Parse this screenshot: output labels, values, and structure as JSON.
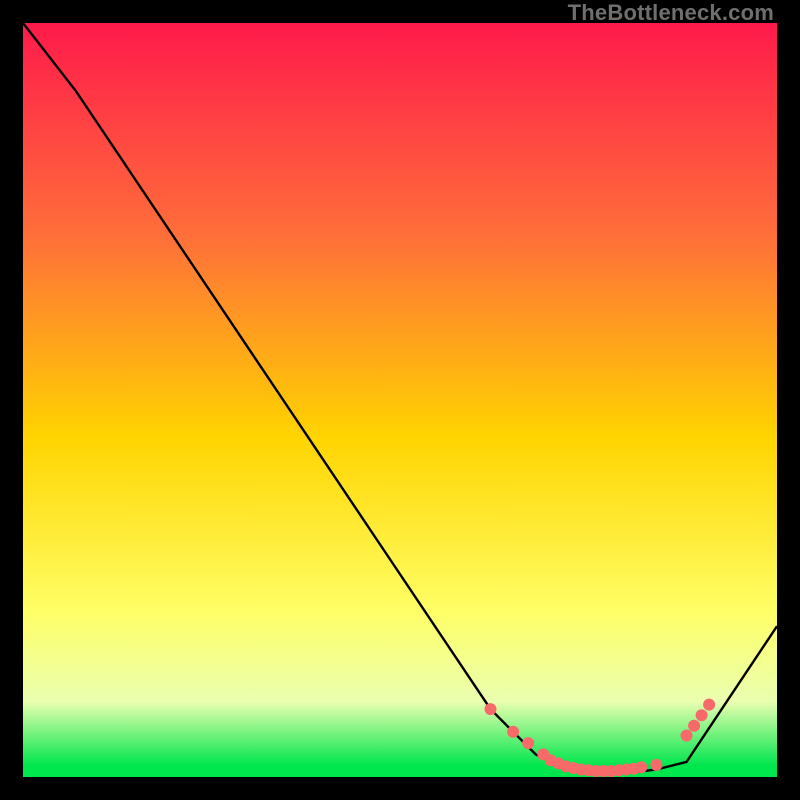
{
  "watermark": "TheBottleneck.com",
  "colors": {
    "grad_top": "#ff1a4b",
    "grad_mid1": "#ff6e3a",
    "grad_mid2": "#ffd400",
    "grad_low": "#ffff66",
    "grad_band": "#eaffb0",
    "grad_green": "#00e64d",
    "line": "#000000",
    "dot": "#f86a6a"
  },
  "chart_data": {
    "type": "line",
    "title": "",
    "xlabel": "",
    "ylabel": "",
    "xlim": [
      0,
      100
    ],
    "ylim": [
      0,
      100
    ],
    "series": [
      {
        "name": "curve",
        "x": [
          0,
          7,
          62,
          68,
          72,
          76,
          80,
          84,
          88,
          100
        ],
        "y": [
          100,
          91,
          9,
          3,
          1,
          0.5,
          0.5,
          1,
          2,
          20
        ]
      }
    ],
    "markers": {
      "name": "dots",
      "x": [
        62,
        65,
        67,
        69,
        70,
        71,
        72,
        73,
        74,
        75,
        76,
        77,
        78,
        79,
        80,
        81,
        82,
        84,
        88,
        89,
        90,
        91
      ],
      "y": [
        9,
        6,
        4.5,
        3,
        2.2,
        1.8,
        1.4,
        1.2,
        1.0,
        0.9,
        0.8,
        0.8,
        0.8,
        0.9,
        1.0,
        1.1,
        1.3,
        1.6,
        5.5,
        6.8,
        8.2,
        9.6
      ]
    }
  }
}
